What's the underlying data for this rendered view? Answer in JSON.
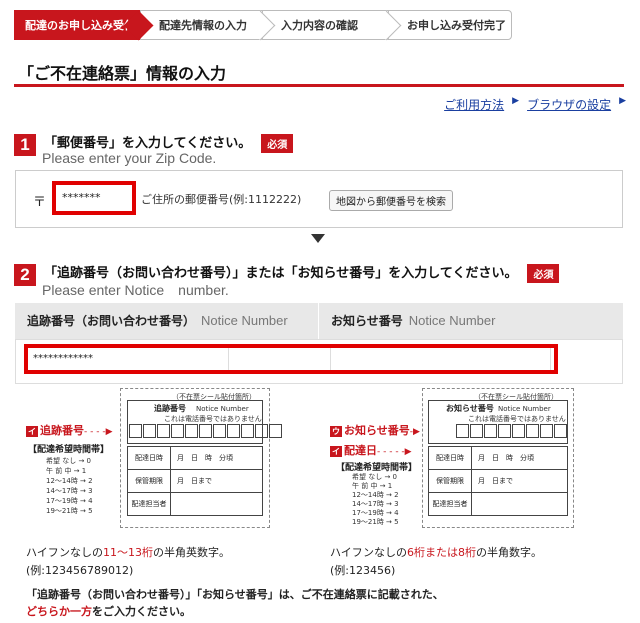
{
  "steps": [
    {
      "label": "配達のお申し込み受付"
    },
    {
      "label": "配達先情報の入力"
    },
    {
      "label": "入力内容の確認"
    },
    {
      "label": "お申し込み受付完了"
    }
  ],
  "page_title": "「ご不在連絡票」情報の入力",
  "links": {
    "usage": "ご利用方法",
    "browser": "ブラウザの設定"
  },
  "section1": {
    "number": "1",
    "title_ja": "「郵便番号」を入力してください。",
    "required": "必須",
    "title_en": "Please enter your Zip Code.",
    "postal_mark": "〒",
    "zip_value": "*******",
    "hint": "ご住所の郵便番号(例:1112222)",
    "map_button": "地図から郵便番号を検索"
  },
  "section2": {
    "number": "2",
    "title_ja": "「追跡番号（お問い合わせ番号）」または「お知らせ番号」を入力してください。",
    "required": "必須",
    "title_en": "Please enter Notice　number.",
    "col1_ja": "追跡番号（お問い合わせ番号）",
    "col1_en": "Notice Number",
    "col2_ja": "お知らせ番号",
    "col2_en": "Notice Number",
    "notice_value": "************"
  },
  "card_left": {
    "header": "（不在票シール貼付箇所）",
    "field_title": "追跡番号",
    "field_sub": "Notice Number",
    "field_note": "これは電話番号ではありません",
    "label_tracking": "追跡番号",
    "label_tracking_letter": "イ",
    "time_title": "【配達希望時間帯】",
    "time_list": [
      "希望 なし → 0",
      "午 前 中 → 1",
      "12～14時 → 2",
      "14～17時 → 3",
      "17～19時 → 4",
      "19～21時 → 5"
    ],
    "rows": [
      "配達日時",
      "保管期限",
      "配達担当者"
    ],
    "row_values": [
      "月　日　時　分頃",
      "月　日まで",
      ""
    ],
    "caption_pre": "ハイフンなしの",
    "caption_red": "11～13桁",
    "caption_post": "の半角英数字。",
    "example": "(例:123456789012)"
  },
  "card_right": {
    "header": "（不在票シール貼付箇所）",
    "field_title": "お知らせ番号",
    "field_sub": "Notice Number",
    "field_note": "これは電話番号ではありません",
    "label_notice": "お知らせ番号",
    "label_notice_letter": "ウ",
    "label_date": "配達日",
    "label_date_letter": "イ",
    "time_title": "【配達希望時間帯】",
    "time_list": [
      "希望 なし → 0",
      "午 前 中 → 1",
      "12～14時 → 2",
      "14～17時 → 3",
      "17～19時 → 4",
      "19～21時 → 5"
    ],
    "rows": [
      "配達日時",
      "保管期限",
      "配達担当者"
    ],
    "row_values": [
      "月　日　時　分頃",
      "月　日まで",
      ""
    ],
    "caption_pre": "ハイフンなしの",
    "caption_red": "6桁または8桁",
    "caption_post": "の半角数字。",
    "example": "(例:123456)"
  },
  "note": {
    "line1": "「追跡番号（お問い合わせ番号）」「お知らせ番号」は、ご不在連絡票に記載された、",
    "line2_red": "どちらか一方",
    "line2_post": "をご入力ください。"
  },
  "colors": {
    "accent": "#c8161d",
    "highlight": "#e00000"
  }
}
